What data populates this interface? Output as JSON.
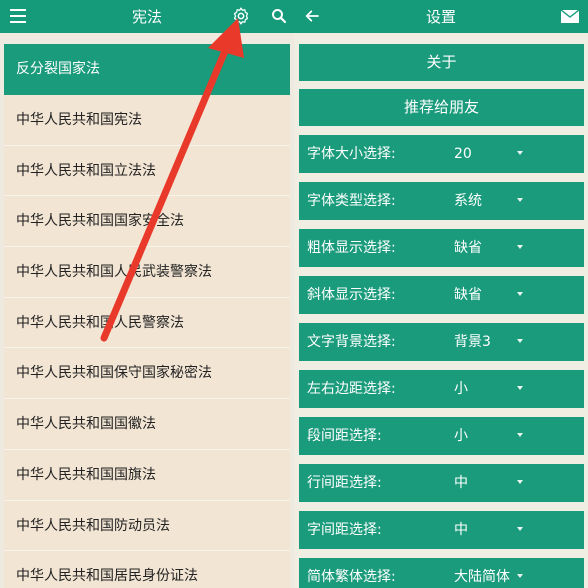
{
  "left_screen": {
    "title": "宪法",
    "first_item": "反分裂国家法",
    "laws": [
      "中华人民共和国宪法",
      "中华人民共和国立法法",
      "中华人民共和国国家安全法",
      "中华人民共和国人民武装警察法",
      "中华人民共和国人民警察法",
      "中华人民共和国保守国家秘密法",
      "中华人民共和国国徽法",
      "中华人民共和国国旗法",
      "中华人民共和国防动员法",
      "中华人民共和国居民身份证法"
    ]
  },
  "right_screen": {
    "title": "设置",
    "about_label": "关于",
    "recommend_label": "推荐给朋友",
    "settings": [
      {
        "label": "字体大小选择:",
        "value": "20"
      },
      {
        "label": "字体类型选择:",
        "value": "系统"
      },
      {
        "label": "粗体显示选择:",
        "value": "缺省"
      },
      {
        "label": "斜体显示选择:",
        "value": "缺省"
      },
      {
        "label": "文字背景选择:",
        "value": "背景3"
      },
      {
        "label": "左右边距选择:",
        "value": "小"
      },
      {
        "label": "段间距选择:",
        "value": "小"
      },
      {
        "label": "行间距选择:",
        "value": "中"
      },
      {
        "label": "字间距选择:",
        "value": "中"
      },
      {
        "label": "简体繁体选择:",
        "value": "大陆简体"
      }
    ]
  },
  "colors": {
    "accent": "#159a7a",
    "list_bg": "#f2e5d4",
    "annotation_arrow": "#e8392a"
  },
  "icons": [
    "menu-icon",
    "settings-gear-icon",
    "search-icon",
    "back-arrow-icon",
    "mail-icon"
  ]
}
